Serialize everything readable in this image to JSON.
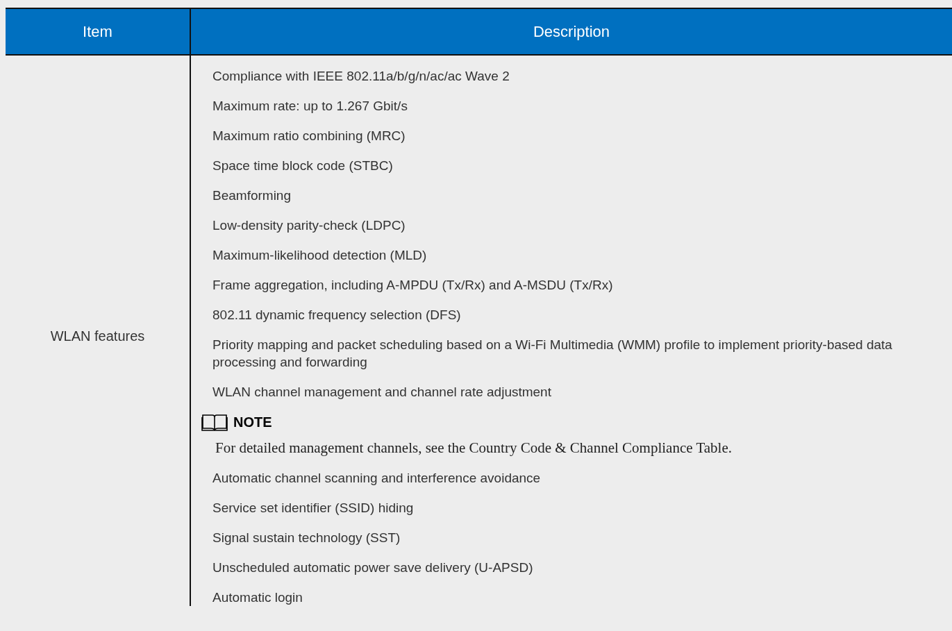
{
  "table": {
    "columns": [
      "Item",
      "Description"
    ],
    "rows": [
      {
        "item": "WLAN features",
        "description": [
          {
            "kind": "item",
            "text": "Compliance with IEEE 802.11a/b/g/n/ac/ac Wave 2"
          },
          {
            "kind": "item",
            "text": "Maximum rate: up to 1.267 Gbit/s"
          },
          {
            "kind": "item",
            "text": "Maximum ratio combining (MRC)"
          },
          {
            "kind": "item",
            "text": "Space time block code (STBC)"
          },
          {
            "kind": "item",
            "text": "Beamforming"
          },
          {
            "kind": "item",
            "text": "Low-density parity-check (LDPC)"
          },
          {
            "kind": "item",
            "text": "Maximum-likelihood detection (MLD)"
          },
          {
            "kind": "item",
            "text": "Frame aggregation, including A-MPDU (Tx/Rx) and A-MSDU (Tx/Rx)"
          },
          {
            "kind": "item",
            "text": "802.11 dynamic frequency selection (DFS)"
          },
          {
            "kind": "item",
            "text": "Priority mapping and packet scheduling based on a Wi-Fi Multimedia (WMM) profile to implement priority-based data processing and forwarding"
          },
          {
            "kind": "item",
            "text": "WLAN channel management and channel rate adjustment"
          },
          {
            "kind": "note",
            "label": "NOTE",
            "text": "For detailed management channels, see the Country Code & Channel Compliance Table."
          },
          {
            "kind": "item",
            "text": "Automatic channel scanning and interference avoidance"
          },
          {
            "kind": "item",
            "text": "Service set identifier (SSID) hiding"
          },
          {
            "kind": "item",
            "text": "Signal sustain technology (SST)"
          },
          {
            "kind": "item",
            "text": "Unscheduled automatic power save delivery (U-APSD)"
          },
          {
            "kind": "item",
            "text": "Automatic login"
          }
        ]
      }
    ]
  }
}
